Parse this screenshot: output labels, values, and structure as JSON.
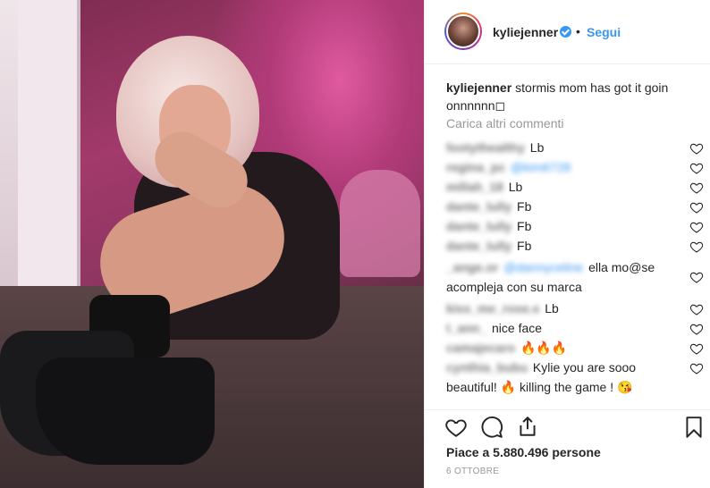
{
  "post": {
    "username": "kyliejenner",
    "follow_label": "Segui",
    "separator": "•",
    "caption_user": "kyliejenner",
    "caption_text": "stormis mom has got it goin onnnnnn◻",
    "load_more_label": "Carica altri commenti",
    "likes_text": "Piace a 5.880.496 persone",
    "date_text": "6 OTTOBRE"
  },
  "comments": [
    {
      "user": "footythealthy",
      "mention": "",
      "text": "Lb"
    },
    {
      "user": "regina_pc",
      "mention": "@kim6728",
      "text": ""
    },
    {
      "user": "millah_18",
      "mention": "",
      "text": "Lb"
    },
    {
      "user": "dante_lully",
      "mention": "",
      "text": "Fb"
    },
    {
      "user": "dante_lully",
      "mention": "",
      "text": "Fb"
    },
    {
      "user": "dante_lully",
      "mention": "",
      "text": "Fb"
    },
    {
      "user": "_ange.or",
      "mention": "@dannyceline",
      "text": "ella mo@se acompleja con su marca"
    },
    {
      "user": "kiss_me_rose.s",
      "mention": "",
      "text": "Lb"
    },
    {
      "user": "t_ann_",
      "mention": "",
      "text": "nice face"
    },
    {
      "user": "camajecaro",
      "mention": "",
      "text": "🔥🔥🔥"
    },
    {
      "user": "cynthia_bubu",
      "mention": "",
      "text": "Kylie you are sooo beautiful! 🔥 killing the game ! 😘"
    }
  ],
  "colors": {
    "link": "#3897f0",
    "muted": "#999999",
    "text": "#262626",
    "verified": "#3897f0"
  },
  "icons": {
    "like": "heart-icon",
    "comment": "comment-bubble-icon",
    "share": "share-icon",
    "save": "bookmark-icon"
  }
}
